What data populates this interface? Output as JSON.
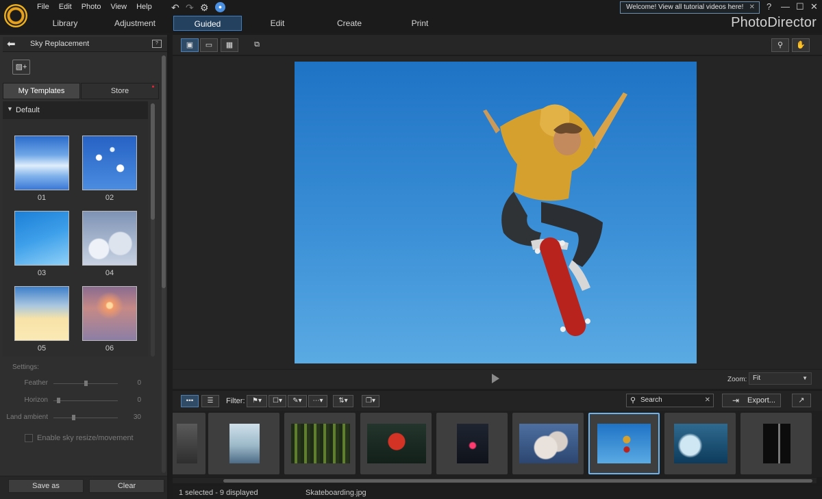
{
  "menu": [
    "File",
    "Edit",
    "Photo",
    "View",
    "Help"
  ],
  "welcome_banner": "Welcome! View all tutorial videos here!",
  "main_tabs": [
    {
      "label": "Library"
    },
    {
      "label": "Adjustment"
    },
    {
      "label": "Guided"
    },
    {
      "label": "Edit"
    },
    {
      "label": "Create"
    },
    {
      "label": "Print"
    }
  ],
  "active_tab": "Guided",
  "brand": "PhotoDirector",
  "left_panel": {
    "title": "Sky Replacement",
    "subtabs": [
      "My Templates",
      "Store"
    ],
    "group_label": "Default",
    "templates": [
      "01",
      "02",
      "03",
      "04",
      "05",
      "06"
    ],
    "settings_heading": "Settings:",
    "settings": [
      {
        "label": "Feather",
        "value": "0",
        "level": 0.5
      },
      {
        "label": "Horizon",
        "value": "0",
        "level": 0.05
      },
      {
        "label": "Land ambient",
        "value": "30",
        "level": 0.3
      }
    ],
    "checkbox_label": "Enable sky resize/movement",
    "save_as": "Save as",
    "clear": "Clear"
  },
  "viewer": {
    "zoom_label": "Zoom:",
    "zoom_value": "Fit"
  },
  "filter_bar": {
    "filter_label": "Filter:",
    "search_placeholder": "Search",
    "export_label": "Export..."
  },
  "status": {
    "selection": "1 selected - 9 displayed",
    "filename": "Skateboarding.jpg"
  },
  "colors": {
    "accent": "#3f7fc0",
    "selected_border": "#6db4ef",
    "sky_top": "#1f73c5",
    "sky_bottom": "#5aaae3"
  }
}
